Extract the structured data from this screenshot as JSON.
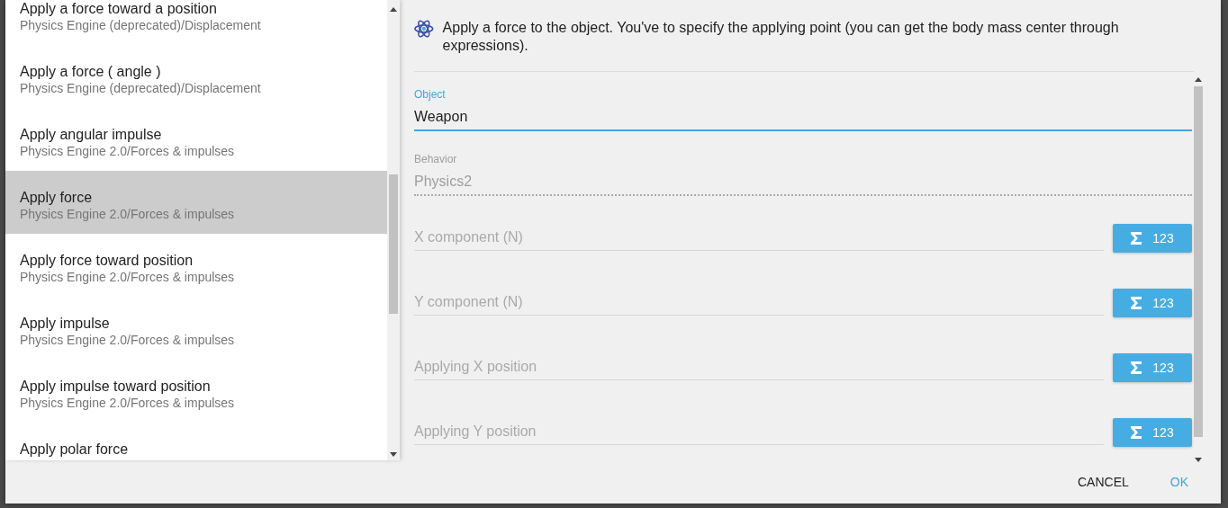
{
  "instruction_list": {
    "items": [
      {
        "title": "Apply a force toward a position",
        "subtitle": "Physics Engine (deprecated)/Displacement",
        "selected": false
      },
      {
        "title": "Apply a force ( angle )",
        "subtitle": "Physics Engine (deprecated)/Displacement",
        "selected": false
      },
      {
        "title": "Apply angular impulse",
        "subtitle": "Physics Engine 2.0/Forces & impulses",
        "selected": false
      },
      {
        "title": "Apply force",
        "subtitle": "Physics Engine 2.0/Forces & impulses",
        "selected": true
      },
      {
        "title": "Apply force toward position",
        "subtitle": "Physics Engine 2.0/Forces & impulses",
        "selected": false
      },
      {
        "title": "Apply impulse",
        "subtitle": "Physics Engine 2.0/Forces & impulses",
        "selected": false
      },
      {
        "title": "Apply impulse toward position",
        "subtitle": "Physics Engine 2.0/Forces & impulses",
        "selected": false
      },
      {
        "title": "Apply polar force",
        "selected": false
      }
    ]
  },
  "description": "Apply a force to the object. You've to specify the applying point (you can get the body mass center through expressions).",
  "parameters": [
    {
      "kind": "select",
      "label": "Object",
      "value": "Weapon",
      "focused": true,
      "disabled": false
    },
    {
      "kind": "select",
      "label": "Behavior",
      "value": "Physics2",
      "focused": false,
      "disabled": true
    },
    {
      "kind": "expression",
      "placeholder": "X component (N)",
      "button": "123"
    },
    {
      "kind": "expression",
      "placeholder": "Y component (N)",
      "button": "123"
    },
    {
      "kind": "expression",
      "placeholder": "Applying X position",
      "button": "123"
    },
    {
      "kind": "expression",
      "placeholder": "Applying Y position",
      "button": "123"
    }
  ],
  "buttons": [
    {
      "label": "CANCEL",
      "primary": false
    },
    {
      "label": "OK",
      "primary": true
    }
  ]
}
